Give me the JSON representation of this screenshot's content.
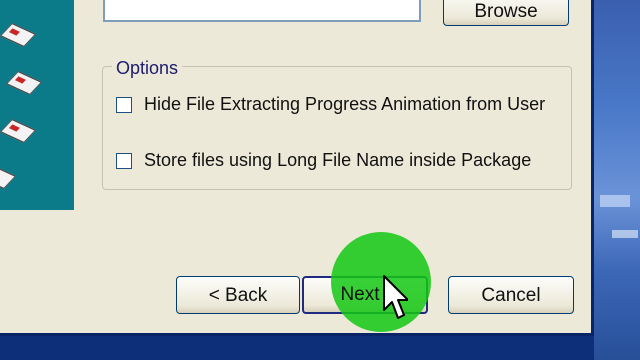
{
  "file_section": {
    "path_value": "",
    "browse_label": "Browse"
  },
  "options": {
    "title": "Options",
    "items": [
      {
        "label": "Hide File Extracting Progress Animation from User",
        "checked": false
      },
      {
        "label": "Store files using Long File Name inside Package",
        "checked": false
      }
    ]
  },
  "nav": {
    "back_label": "< Back",
    "next_label": "Next",
    "cancel_label": "Cancel"
  },
  "colors": {
    "side_panel": "#0b7b8a",
    "dialog_bg": "#ece9d8",
    "click_highlight": "#14c814"
  }
}
